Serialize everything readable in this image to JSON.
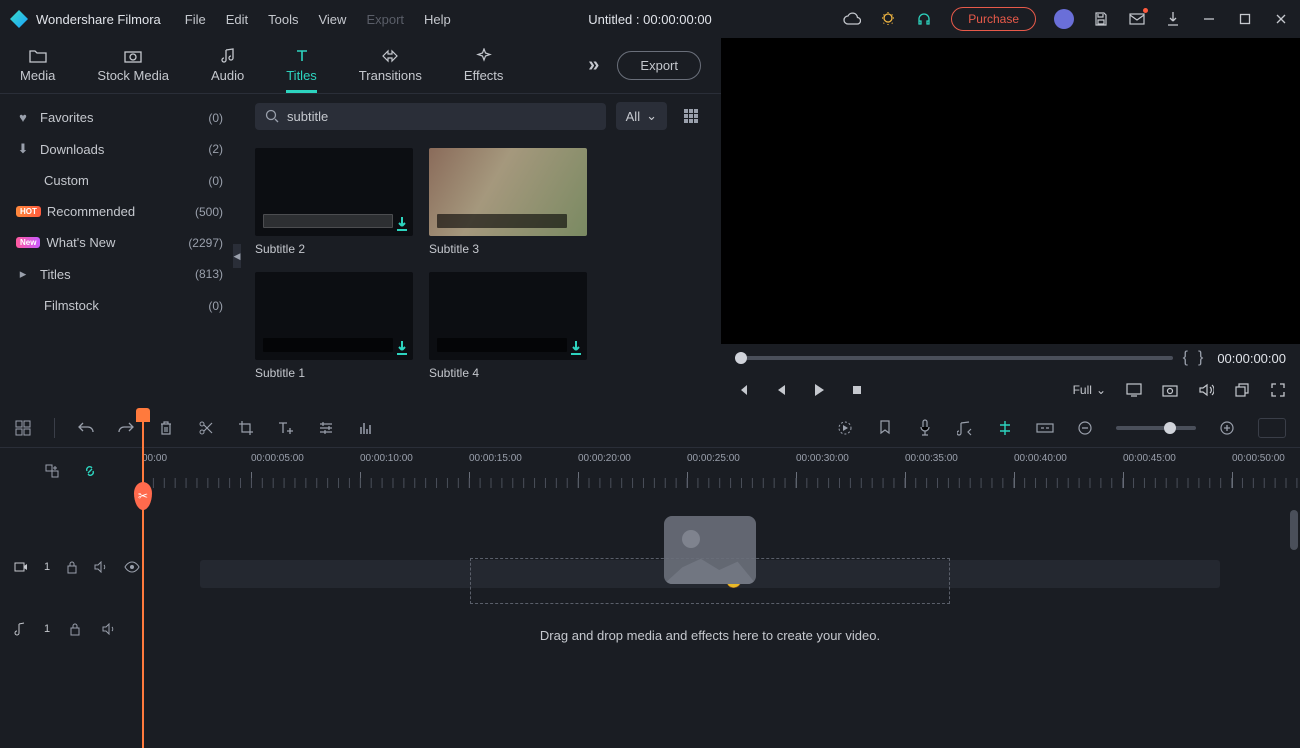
{
  "app": {
    "name": "Wondershare Filmora"
  },
  "menu": {
    "file": "File",
    "edit": "Edit",
    "tools": "Tools",
    "view": "View",
    "export": "Export",
    "help": "Help"
  },
  "project": {
    "title": "Untitled : 00:00:00:00"
  },
  "titlebar": {
    "purchase": "Purchase"
  },
  "tabs": {
    "media": "Media",
    "stock": "Stock Media",
    "audio": "Audio",
    "titles": "Titles",
    "transitions": "Transitions",
    "effects": "Effects",
    "export_btn": "Export"
  },
  "sidebar": {
    "items": [
      {
        "icon": "heart",
        "label": "Favorites",
        "count": "(0)"
      },
      {
        "icon": "download",
        "label": "Downloads",
        "count": "(2)"
      },
      {
        "indent": true,
        "label": "Custom",
        "count": "(0)"
      },
      {
        "badge": "HOT",
        "label": "Recommended",
        "count": "(500)"
      },
      {
        "badge": "New",
        "label": "What's New",
        "count": "(2297)"
      },
      {
        "icon": "caret",
        "label": "Titles",
        "count": "(813)"
      },
      {
        "indent": true,
        "label": "Filmstock",
        "count": "(0)"
      }
    ]
  },
  "search": {
    "value": "subtitle"
  },
  "filter": {
    "label": "All"
  },
  "thumbs": [
    {
      "label": "Subtitle 2",
      "photo": false
    },
    {
      "label": "Subtitle 3",
      "photo": true
    },
    {
      "label": "Subtitle 1",
      "photo": false
    },
    {
      "label": "Subtitle 4",
      "photo": false
    }
  ],
  "preview": {
    "timecode": "00:00:00:00",
    "resolution": "Full"
  },
  "ruler": [
    "00:00",
    "00:00:05:00",
    "00:00:10:00",
    "00:00:15:00",
    "00:00:20:00",
    "00:00:25:00",
    "00:00:30:00",
    "00:00:35:00",
    "00:00:40:00",
    "00:00:45:00",
    "00:00:50:00"
  ],
  "timeline": {
    "drop_hint": "Drag and drop media and effects here to create your video.",
    "video_track": "1",
    "audio_track": "1"
  }
}
